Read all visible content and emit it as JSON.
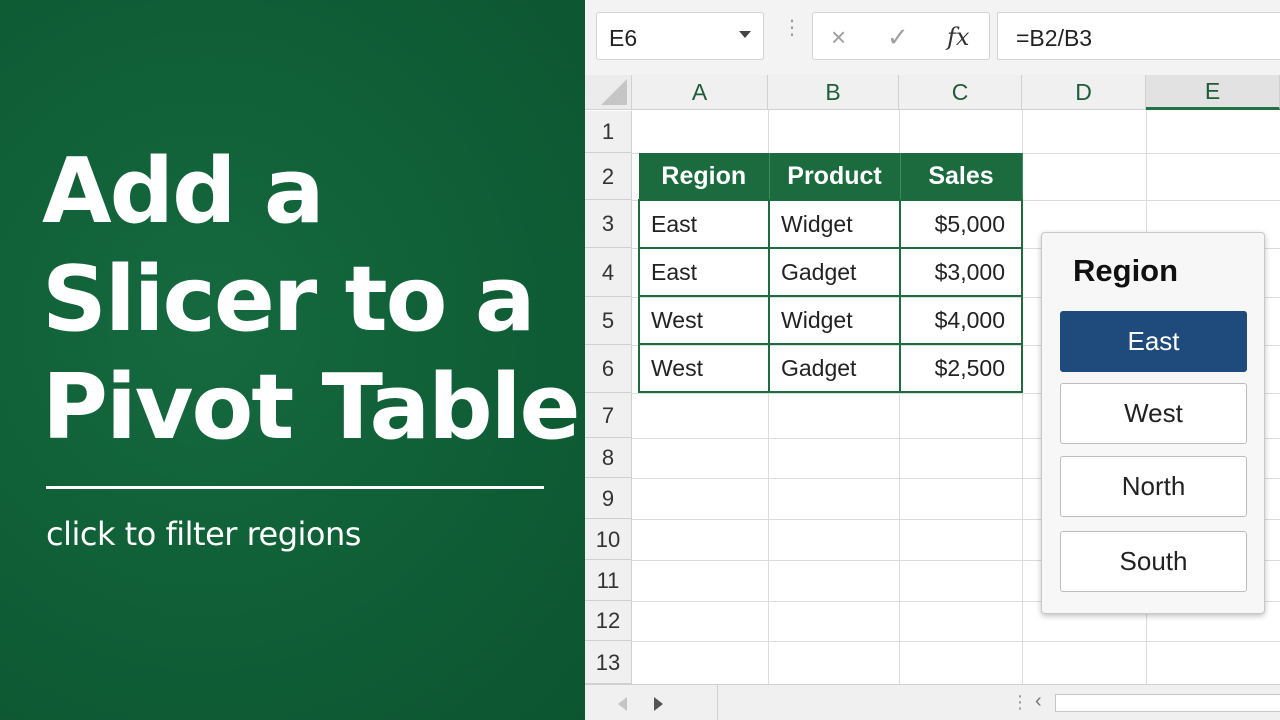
{
  "promo": {
    "headline_lines": [
      "Add a",
      "Slicer to a",
      "Pivot Table"
    ],
    "subtitle": "click to filter regions"
  },
  "formula_bar": {
    "name_box": "E6",
    "cancel_icon": "×",
    "enter_icon": "✓",
    "fx_label": "fx",
    "formula": "=B2/B3"
  },
  "columns": [
    "A",
    "B",
    "C",
    "D",
    "E"
  ],
  "selected_column": "E",
  "rows": [
    "1",
    "2",
    "3",
    "4",
    "5",
    "6",
    "7",
    "8",
    "9",
    "10",
    "11",
    "12",
    "13"
  ],
  "table": {
    "headers": [
      "Region",
      "Product",
      "Sales"
    ],
    "rows": [
      [
        "East",
        "Widget",
        "$5,000"
      ],
      [
        "East",
        "Gadget",
        "$3,000"
      ],
      [
        "West",
        "Widget",
        "$4,000"
      ],
      [
        "West",
        "Gadget",
        "$2,500"
      ]
    ]
  },
  "slicer": {
    "title": "Region",
    "items": [
      {
        "label": "East",
        "selected": true
      },
      {
        "label": "West",
        "selected": false
      },
      {
        "label": "North",
        "selected": false
      },
      {
        "label": "South",
        "selected": false
      }
    ]
  },
  "colors": {
    "brand_green": "#0f5e36",
    "table_header_green": "#1c6b3f",
    "slicer_selected": "#1e4a7c"
  }
}
